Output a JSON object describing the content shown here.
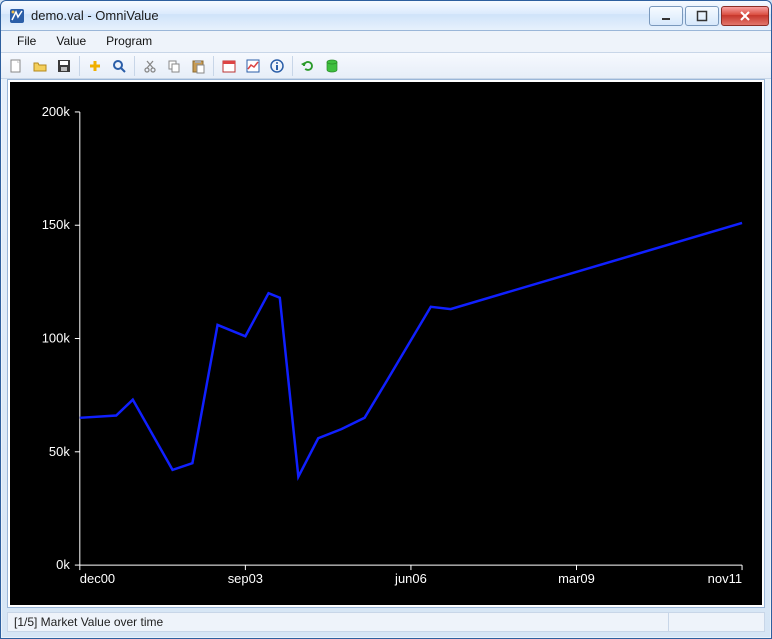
{
  "window": {
    "title": "demo.val - OmniValue",
    "controls": {
      "minimize": "minimize",
      "maximize": "maximize",
      "close": "close"
    }
  },
  "menubar": [
    "File",
    "Value",
    "Program"
  ],
  "toolbar_icons": [
    "new",
    "open",
    "save",
    "sep",
    "add",
    "find",
    "sep",
    "cut",
    "copy",
    "paste",
    "sep",
    "calendar",
    "chart",
    "info",
    "sep",
    "refresh",
    "database"
  ],
  "statusbar": {
    "text": "[1/5] Market Value over time"
  },
  "chart_data": {
    "type": "line",
    "title": "",
    "xlabel": "",
    "ylabel": "",
    "y_ticks": [
      0,
      50000,
      100000,
      150000,
      200000
    ],
    "y_tick_labels": [
      "0k",
      "50k",
      "100k",
      "150k",
      "200k"
    ],
    "x_tick_labels": [
      "dec00",
      "sep03",
      "jun06",
      "mar09",
      "nov11"
    ],
    "x_tick_positions": [
      0,
      0.25,
      0.5,
      0.75,
      1.0
    ],
    "ylim": [
      0,
      200000
    ],
    "series": [
      {
        "name": "Market Value",
        "points": [
          {
            "x": 0.0,
            "y": 65000
          },
          {
            "x": 0.055,
            "y": 66000
          },
          {
            "x": 0.08,
            "y": 73000
          },
          {
            "x": 0.14,
            "y": 42000
          },
          {
            "x": 0.17,
            "y": 45000
          },
          {
            "x": 0.208,
            "y": 106000
          },
          {
            "x": 0.25,
            "y": 101000
          },
          {
            "x": 0.285,
            "y": 120000
          },
          {
            "x": 0.302,
            "y": 118000
          },
          {
            "x": 0.33,
            "y": 39000
          },
          {
            "x": 0.36,
            "y": 56000
          },
          {
            "x": 0.395,
            "y": 60000
          },
          {
            "x": 0.43,
            "y": 65000
          },
          {
            "x": 0.465,
            "y": 82000
          },
          {
            "x": 0.53,
            "y": 114000
          },
          {
            "x": 0.56,
            "y": 113000
          },
          {
            "x": 1.0,
            "y": 151000
          }
        ]
      }
    ]
  }
}
